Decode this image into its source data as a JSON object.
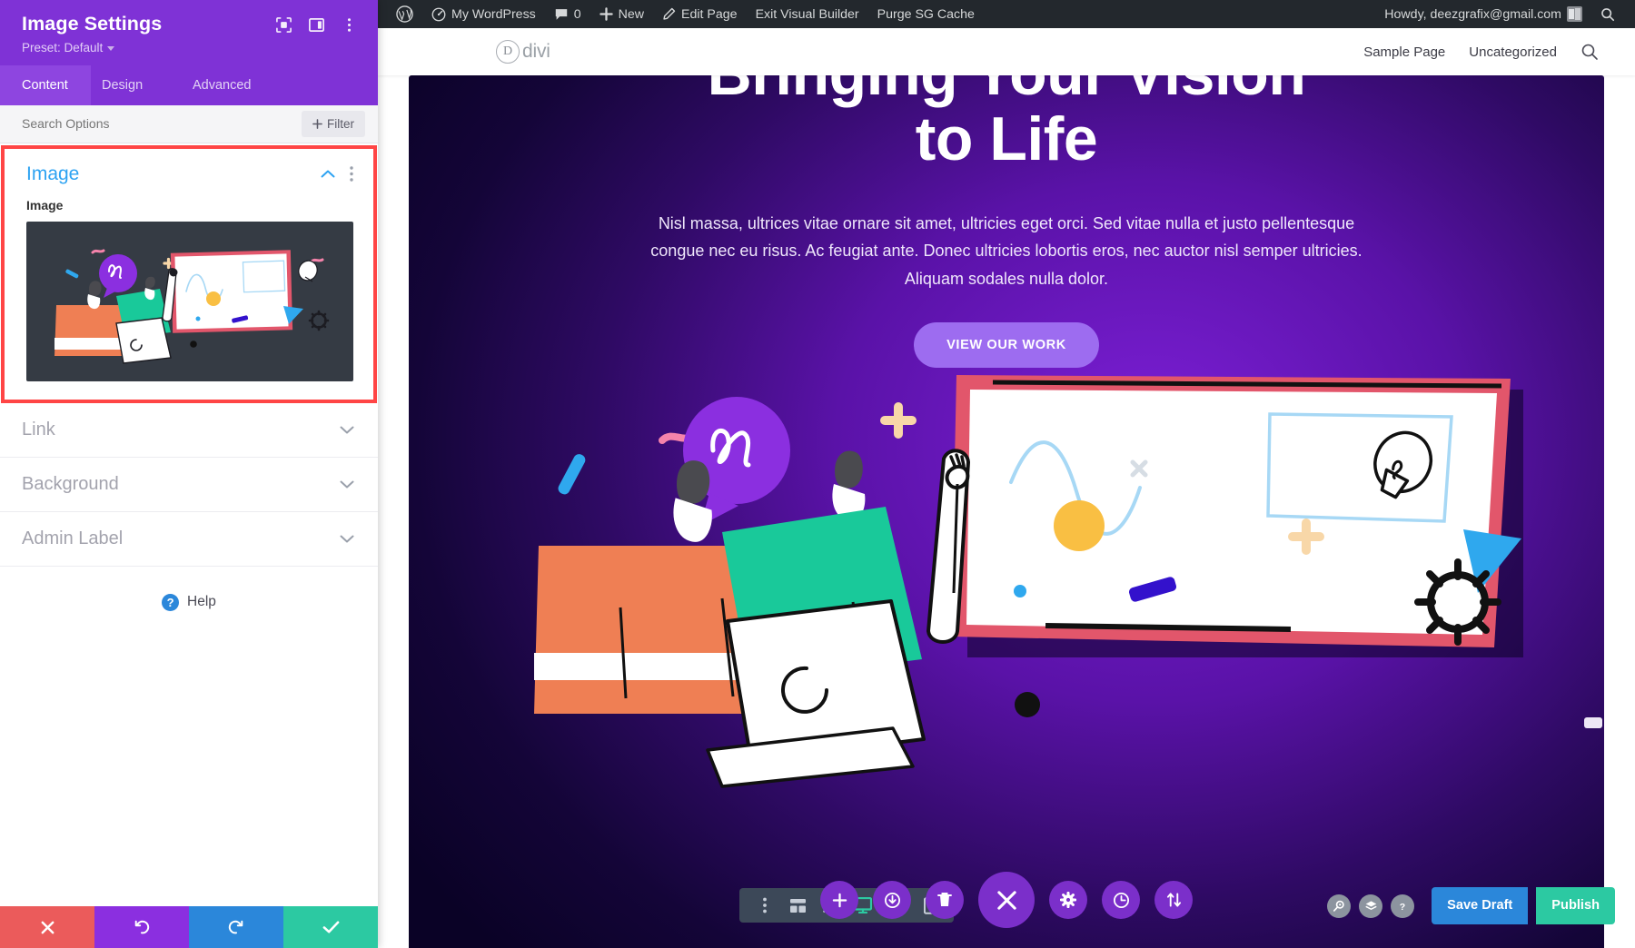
{
  "settings_panel": {
    "title": "Image Settings",
    "preset_label": "Preset: Default",
    "header_icons": [
      {
        "name": "focus-frame-icon"
      },
      {
        "name": "panel-layout-icon"
      },
      {
        "name": "kebab-menu-icon"
      }
    ],
    "tabs": [
      {
        "label": "Content",
        "active": true
      },
      {
        "label": "Design",
        "active": false
      },
      {
        "label": "Advanced",
        "active": false
      }
    ],
    "search": {
      "placeholder": "Search Options",
      "value": ""
    },
    "filter_button": "Filter",
    "open_section": {
      "title": "Image",
      "field_label": "Image",
      "collapse_icon": "chevron-up-icon",
      "menu_icon": "kebab-menu-icon"
    },
    "collapsed_sections": [
      {
        "title": "Link"
      },
      {
        "title": "Background"
      },
      {
        "title": "Admin Label"
      }
    ],
    "help": {
      "label": "Help",
      "icon": "question-mark-icon"
    },
    "actions": [
      {
        "name": "cancel",
        "icon": "close-x-icon",
        "color": "#eb5b5b"
      },
      {
        "name": "undo",
        "icon": "undo-arrow-icon",
        "color": "#8b2fe0"
      },
      {
        "name": "redo",
        "icon": "redo-arrow-icon",
        "color": "#2b87da"
      },
      {
        "name": "save",
        "icon": "checkmark-icon",
        "color": "#2cc9a2"
      }
    ],
    "colors": {
      "header_bg": "#7f32d6",
      "highlight_border": "#ff4545",
      "section_title": "#2ea3f2"
    }
  },
  "admin_bar": {
    "items": [
      {
        "label": "",
        "icon": "wordpress-logo-icon"
      },
      {
        "label": "My WordPress",
        "icon": "dashboard-icon"
      },
      {
        "label": "0",
        "icon": "comment-bubble-icon"
      },
      {
        "label": "New",
        "icon": "plus-icon"
      },
      {
        "label": "Edit Page",
        "icon": "pencil-icon"
      },
      {
        "label": "Exit Visual Builder",
        "icon": ""
      },
      {
        "label": "Purge SG Cache",
        "icon": ""
      }
    ],
    "greeting": "Howdy, deezgrafix@gmail.com",
    "avatar_icon": "user-avatar-icon",
    "search_icon": "search-icon"
  },
  "site_header": {
    "logo_mark": "D",
    "logo_text": "divi",
    "nav": [
      {
        "label": "Sample Page"
      },
      {
        "label": "Uncategorized"
      }
    ],
    "search_icon": "search-icon"
  },
  "hero": {
    "heading_line1": "Bringing Your Vision",
    "heading_line2": "to Life",
    "paragraph": "Nisl massa, ultrices vitae ornare sit amet, ultricies eget orci. Sed vitae nulla et justo pellentesque congue nec eu risus. Ac feugiat ante. Donec ultricies lobortis eros, nec auctor nisl semper ultricies. Aliquam sodales nulla dolor.",
    "cta_label": "VIEW OUR WORK",
    "colors": {
      "bg_purple": "#6a18c4",
      "bg_dark": "#0d0230",
      "cta_bg": "#9d6cf0",
      "heading": "#ffffff"
    },
    "illustration": {
      "name": "team-whiteboard-illustration",
      "board_frame": "#e2566b",
      "shirt_orange": "#ef7f54",
      "shirt_teal": "#19c99a",
      "bubble_purple": "#8b2fe0",
      "dot_yellow": "#f9bf43",
      "triangle_blue": "#2fa8ee",
      "bar_navy": "#3311cc",
      "squiggle_pink": "#f583ab",
      "plus_peach": "#f8d7a8"
    }
  },
  "responsive_bar": {
    "buttons": [
      {
        "name": "more-options",
        "icon": "kebab-menu-icon",
        "active": false
      },
      {
        "name": "wireframe-view",
        "icon": "wireframe-icon",
        "active": false
      },
      {
        "name": "zoom-out-view",
        "icon": "magnifier-icon",
        "active": false
      },
      {
        "name": "desktop-view",
        "icon": "desktop-monitor-icon",
        "active": true
      },
      {
        "name": "tablet-view",
        "icon": "tablet-icon",
        "active": false
      },
      {
        "name": "phone-view",
        "icon": "phone-icon",
        "active": false
      }
    ],
    "active_color": "#2cc9a2"
  },
  "center_actions": {
    "buttons": [
      {
        "name": "add-section",
        "icon": "plus-icon",
        "big": false
      },
      {
        "name": "save-to-library",
        "icon": "power-download-icon",
        "big": false
      },
      {
        "name": "trash",
        "icon": "trash-icon",
        "big": false
      },
      {
        "name": "close-menu",
        "icon": "close-x-icon",
        "big": true
      },
      {
        "name": "settings",
        "icon": "gear-icon",
        "big": false
      },
      {
        "name": "history",
        "icon": "clock-icon",
        "big": false
      },
      {
        "name": "reorder",
        "icon": "up-down-arrows-icon",
        "big": false
      }
    ],
    "color": "#7b2fca"
  },
  "right_actions": {
    "icons": [
      {
        "name": "zoom-toggle",
        "icon": "magnifier-icon"
      },
      {
        "name": "layers",
        "icon": "layers-icon"
      },
      {
        "name": "help",
        "icon": "question-mark-icon"
      }
    ],
    "save_draft_label": "Save Draft",
    "publish_label": "Publish",
    "save_draft_color": "#2b87da",
    "publish_color": "#2cc9a2"
  }
}
